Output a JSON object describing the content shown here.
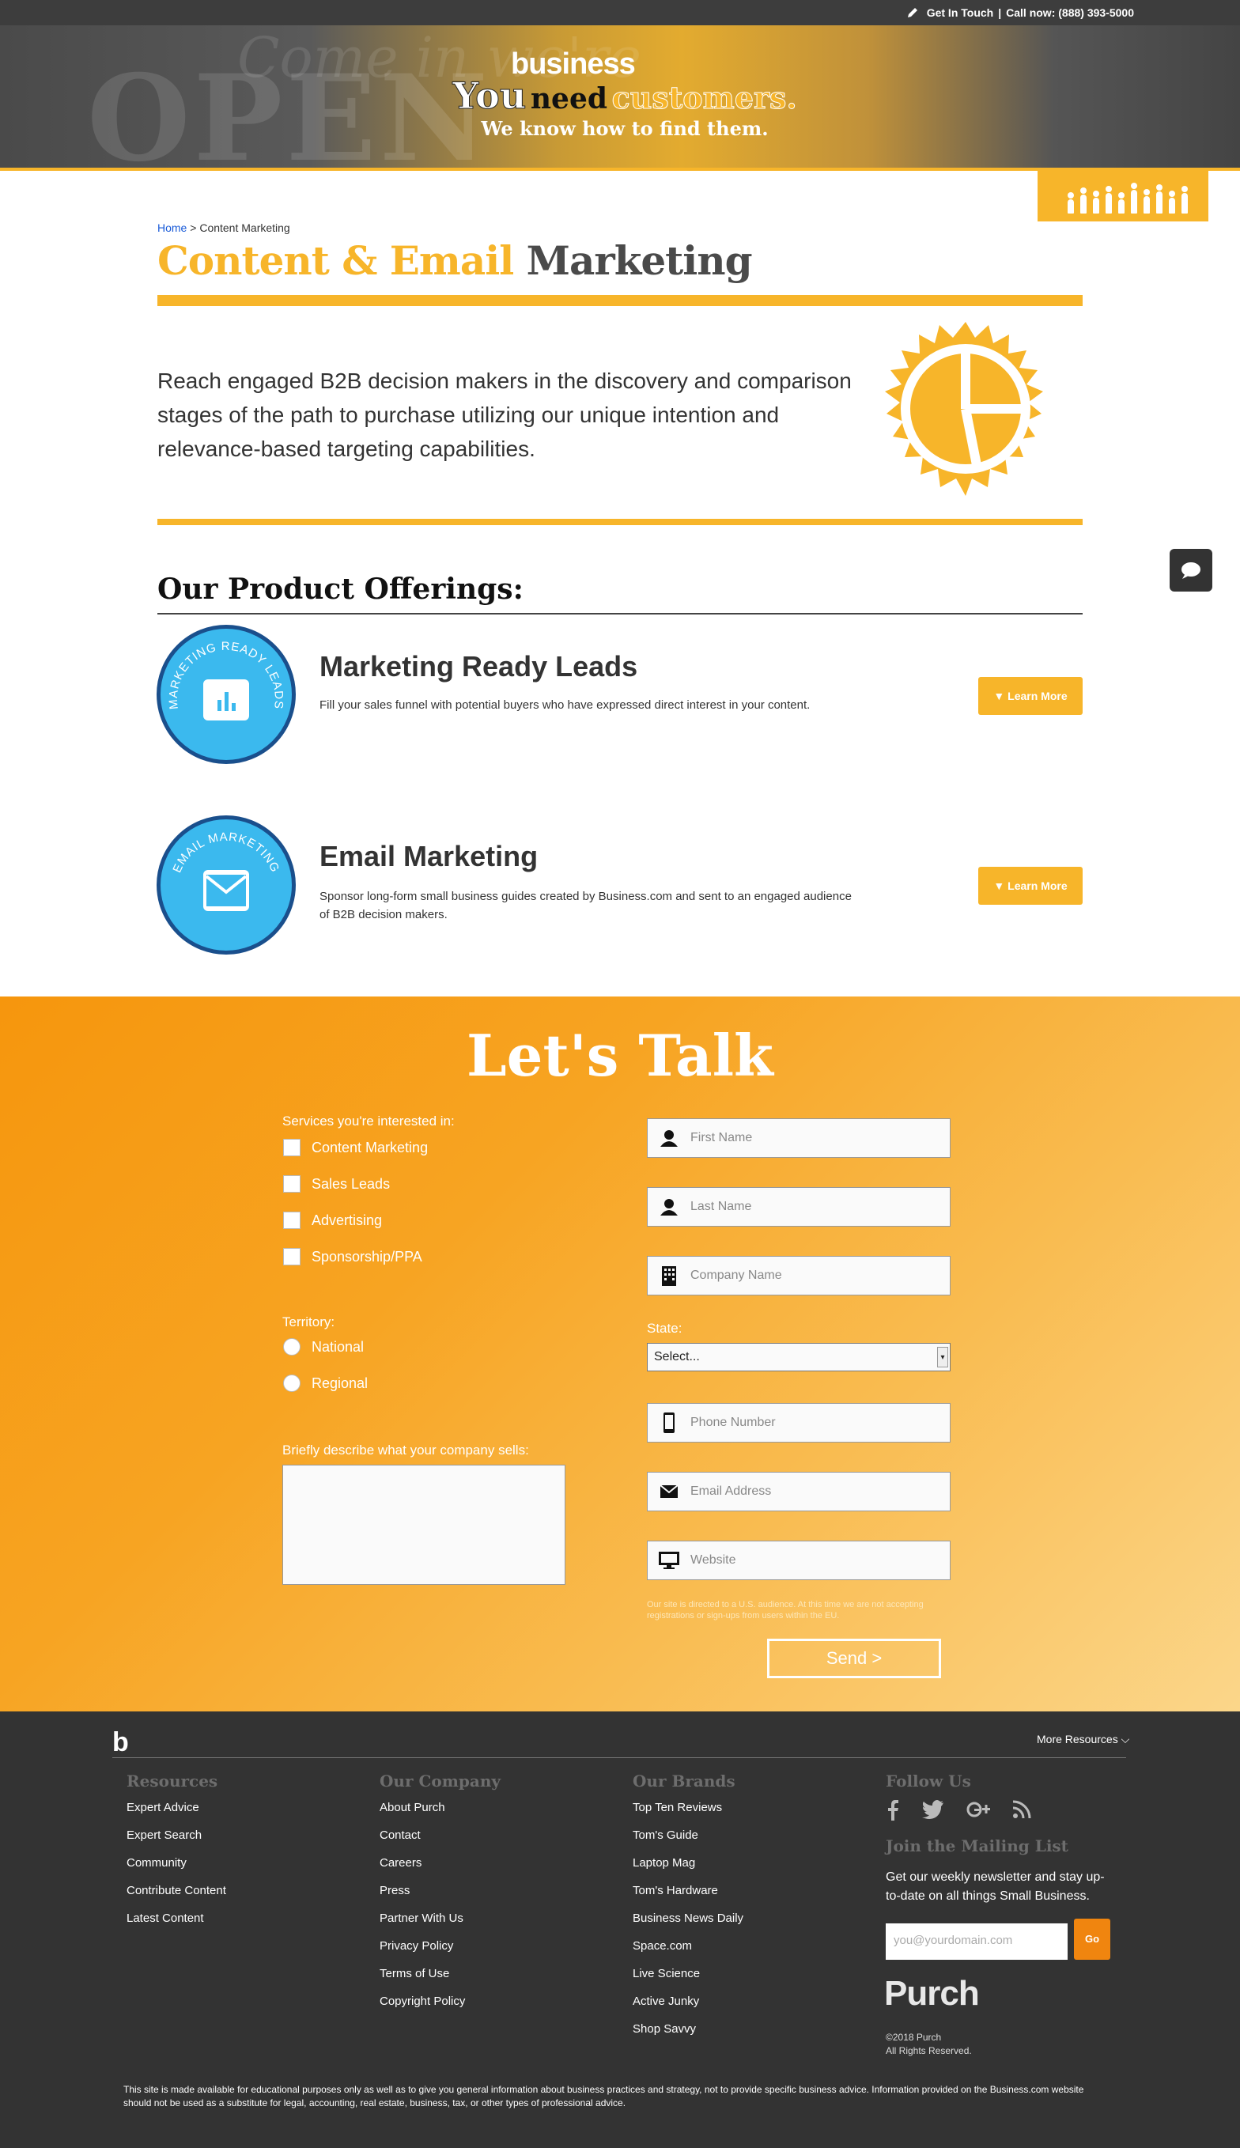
{
  "topbar": {
    "get_in_touch": "Get In Touch",
    "separator": "|",
    "call_now": "Call now: (888) 393-5000"
  },
  "hero": {
    "brand": "business",
    "headline_you": "You",
    "headline_need": "need",
    "headline_customers": "customers.",
    "subheadline": "We know how to find them.",
    "background_word": "OPEN",
    "background_script": "Come in we're"
  },
  "breadcrumb": {
    "home": "Home",
    "sep": ">",
    "current": "Content Marketing"
  },
  "page": {
    "title_highlight": "Content & Email",
    "title_rest": "Marketing",
    "intro": "Reach engaged B2B decision makers in the discovery and comparison stages of the path to purchase utilizing our unique intention and relevance-based targeting capabilities."
  },
  "offerings": {
    "heading": "Our Product Offerings:",
    "items": [
      {
        "badge_text": "MARKETING READY LEADS",
        "name": "Marketing Ready Leads",
        "desc": "Fill your sales funnel with potential buyers who have expressed direct interest in your content.",
        "button": "▼ Learn More",
        "icon": "bar-chart-icon"
      },
      {
        "badge_text": "EMAIL MARKETING",
        "name": "Email Marketing",
        "desc": "Sponsor long-form small business guides created by Business.com and sent to an engaged audience of B2B decision makers.",
        "button": "▼ Learn More",
        "icon": "envelope-icon"
      }
    ]
  },
  "talk": {
    "title": "Let's Talk",
    "services_label": "Services you're interested in:",
    "services": [
      "Content Marketing",
      "Sales Leads",
      "Advertising",
      "Sponsorship/PPA"
    ],
    "territory_label": "Territory:",
    "territories": [
      "National",
      "Regional"
    ],
    "describe_label": "Briefly describe what your company sells:",
    "fields": {
      "first_name": "First Name",
      "last_name": "Last Name",
      "company": "Company Name",
      "phone": "Phone Number",
      "email": "Email Address",
      "website": "Website"
    },
    "state_label": "State:",
    "state_value": "Select...",
    "notice": "Our site is directed to a U.S. audience. At this time we are not accepting registrations or sign-ups from users within the EU.",
    "send": "Send >"
  },
  "footer": {
    "logo": "b",
    "more_resources": "More Resources",
    "resources": {
      "heading": "Resources",
      "links": [
        "Expert Advice",
        "Expert Search",
        "Community",
        "Contribute Content",
        "Latest Content"
      ]
    },
    "company": {
      "heading": "Our Company",
      "links": [
        "About Purch",
        "Contact",
        "Careers",
        "Press",
        "Partner With Us",
        "Privacy Policy",
        "Terms of Use",
        "Copyright Policy"
      ]
    },
    "brands": {
      "heading": "Our Brands",
      "links": [
        "Top Ten Reviews",
        "Tom's Guide",
        "Laptop Mag",
        "Tom's Hardware",
        "Business News Daily",
        "Space.com",
        "Live Science",
        "Active Junky",
        "Shop Savvy"
      ]
    },
    "follow": {
      "heading": "Follow Us",
      "icons": [
        "facebook-icon",
        "twitter-icon",
        "google-plus-icon",
        "rss-icon"
      ]
    },
    "mailing": {
      "heading": "Join the Mailing List",
      "text": "Get our weekly newsletter and stay up-to-date on all things Small Business.",
      "placeholder": "you@yourdomain.com",
      "button": "Go"
    },
    "purch_logo": "Purch",
    "copyright_line1": "©2018 Purch",
    "copyright_line2": "All Rights Reserved.",
    "disclaimer": "This site is made available for educational purposes only as well as to give you general information about business practices and strategy, not to provide specific business advice. Information provided on the Business.com website should not be used as a substitute for legal, accounting, real estate, business, tax, or other types of professional advice."
  },
  "colors": {
    "accent": "#f7b52a",
    "dark": "#333333",
    "badge_blue": "#3bb9ee",
    "badge_border": "#1a4f8c",
    "link": "#1a5bd8"
  }
}
